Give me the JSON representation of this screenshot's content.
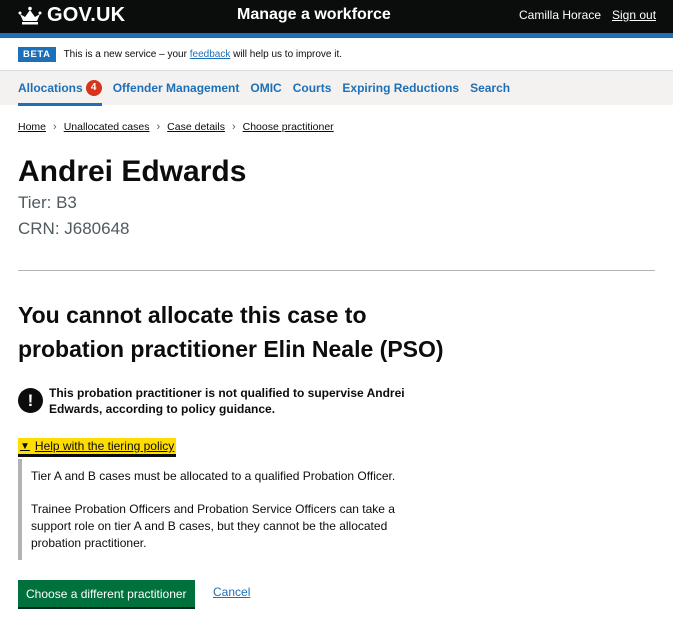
{
  "header": {
    "logo_text": "GOV.UK",
    "service_name": "Manage a workforce",
    "user_name": "Camilla Horace",
    "sign_out": "Sign out"
  },
  "phase_banner": {
    "tag": "BETA",
    "text_before": "This is a new service – your ",
    "link": "feedback",
    "text_after": " will help us to improve it."
  },
  "nav": {
    "items": [
      {
        "label": "Allocations",
        "badge": "4",
        "active": true
      },
      {
        "label": "Offender Management"
      },
      {
        "label": "OMIC"
      },
      {
        "label": "Courts"
      },
      {
        "label": "Expiring Reductions"
      },
      {
        "label": "Search"
      }
    ]
  },
  "breadcrumbs": [
    "Home",
    "Unallocated cases",
    "Case details",
    "Choose practitioner"
  ],
  "case": {
    "name": "Andrei Edwards",
    "tier": "Tier: B3",
    "crn": "CRN: J680648"
  },
  "heading": "You cannot allocate this case to probation practitioner Elin Neale (PSO)",
  "warning": {
    "icon": "!",
    "text": "This probation practitioner is not qualified to supervise Andrei Edwards, according to policy guidance."
  },
  "details": {
    "summary": "Help with the tiering policy",
    "paragraphs": [
      "Tier A and B cases must be allocated to a qualified Probation Officer.",
      "Trainee Probation Officers and Probation Service Officers can take a support role on tier A and B cases, but they cannot be the allocated probation practitioner."
    ]
  },
  "actions": {
    "primary": "Choose a different practitioner",
    "cancel": "Cancel"
  },
  "colors": {
    "header_bg": "#0b0c0c",
    "link": "#1d70b8",
    "badge": "#d4351c",
    "button": "#00703c",
    "focus_yellow": "#ffdd00"
  }
}
